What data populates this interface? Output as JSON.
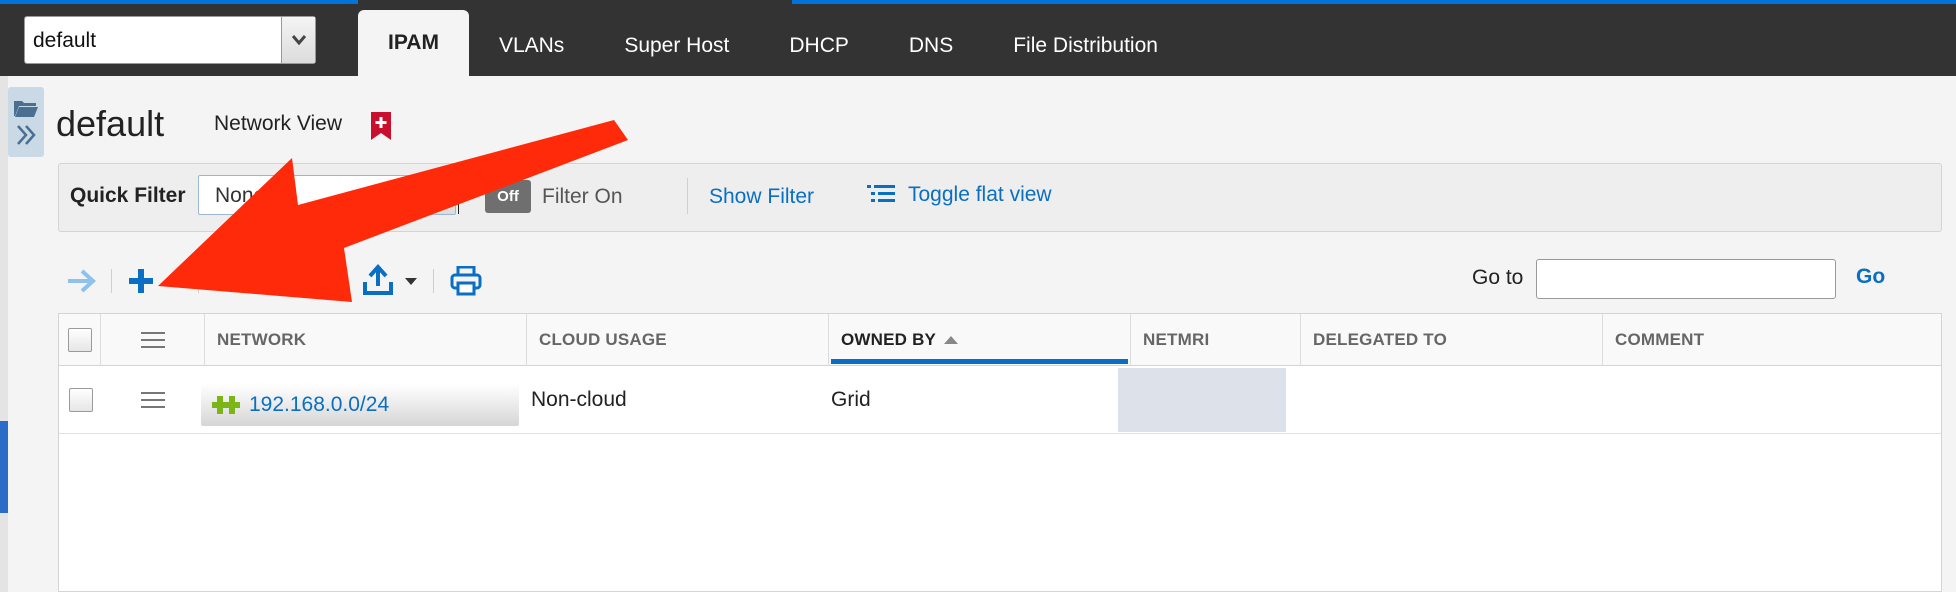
{
  "network_view_select": {
    "value": "default"
  },
  "tabs": [
    {
      "label": "IPAM",
      "active": true
    },
    {
      "label": "VLANs"
    },
    {
      "label": "Super Host"
    },
    {
      "label": "DHCP"
    },
    {
      "label": "DNS"
    },
    {
      "label": "File Distribution"
    }
  ],
  "page": {
    "title": "default",
    "subtitle": "Network View"
  },
  "filter_bar": {
    "quick_filter_label": "Quick Filter",
    "quick_filter_value": "None",
    "toggle_label": "Off",
    "filter_on_label": "Filter On",
    "show_filter": "Show Filter",
    "toggle_flat_view": "Toggle flat view"
  },
  "toolbar": {
    "goto_label": "Go to",
    "goto_value": "",
    "go_button": "Go"
  },
  "table": {
    "columns": [
      "NETWORK",
      "CLOUD USAGE",
      "OWNED BY",
      "NETMRI",
      "DELEGATED TO",
      "COMMENT"
    ],
    "sorted_column": "OWNED BY",
    "rows": [
      {
        "network": "192.168.0.0/24",
        "cloud_usage": "Non-cloud",
        "owned_by": "Grid",
        "netmri": "",
        "delegated_to": "",
        "comment": ""
      }
    ]
  },
  "colors": {
    "accent": "#0a6fc2",
    "topbar": "#333333",
    "annotation_arrow": "#ff2a0a",
    "bookmark": "#c8102e",
    "network_icon": "#7cb518"
  }
}
